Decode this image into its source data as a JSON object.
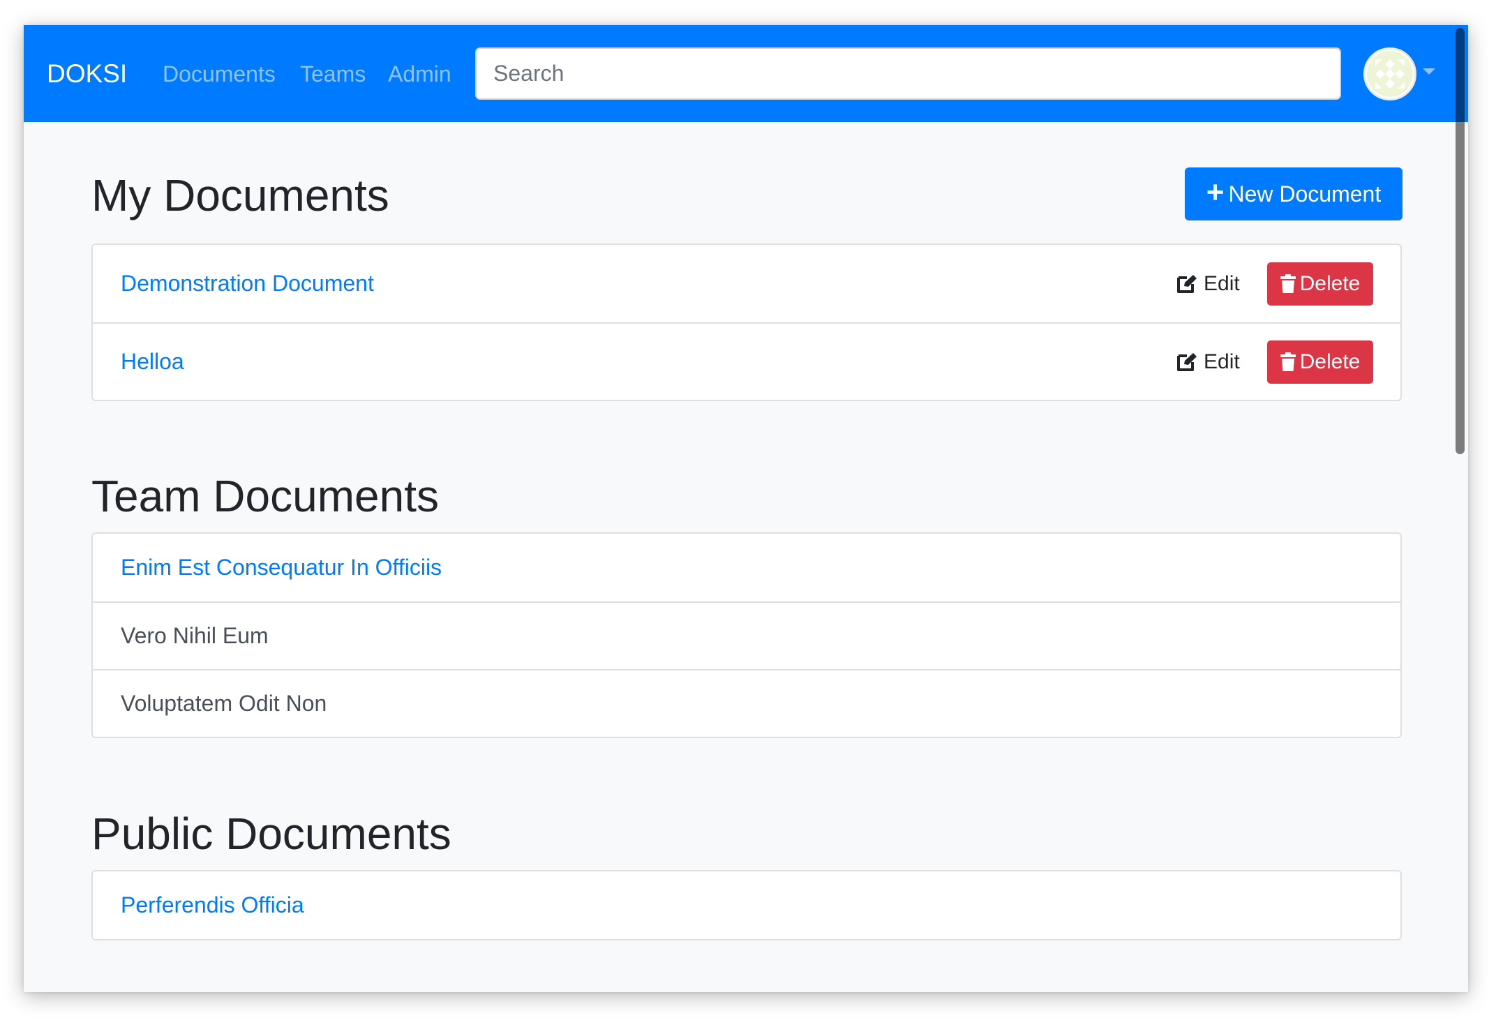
{
  "navbar": {
    "brand": "DOKSI",
    "links": [
      "Documents",
      "Teams",
      "Admin"
    ],
    "search": {
      "placeholder": "Search",
      "value": ""
    },
    "avatar": "user-avatar-identicon",
    "dropdown_icon": "caret-down-icon"
  },
  "colors": {
    "primary": "#007bff",
    "danger": "#dc3545",
    "background": "#f8f9fa",
    "text": "#212529",
    "muted_text": "#495057"
  },
  "my_documents": {
    "title": "My Documents",
    "new_button": {
      "icon": "plus-icon",
      "label": "New Document"
    },
    "items": [
      {
        "name": "Demonstration Document",
        "edit_label": "Edit",
        "delete_label": "Delete"
      },
      {
        "name": "Helloa",
        "edit_label": "Edit",
        "delete_label": "Delete"
      }
    ]
  },
  "team_documents": {
    "title": "Team Documents",
    "items": [
      {
        "name": "Enim Est Consequatur In Officiis",
        "link": true
      },
      {
        "name": "Vero Nihil Eum",
        "link": false
      },
      {
        "name": "Voluptatem Odit Non",
        "link": false
      }
    ]
  },
  "public_documents": {
    "title": "Public Documents",
    "items": [
      {
        "name": "Perferendis Officia",
        "link": true
      }
    ]
  }
}
